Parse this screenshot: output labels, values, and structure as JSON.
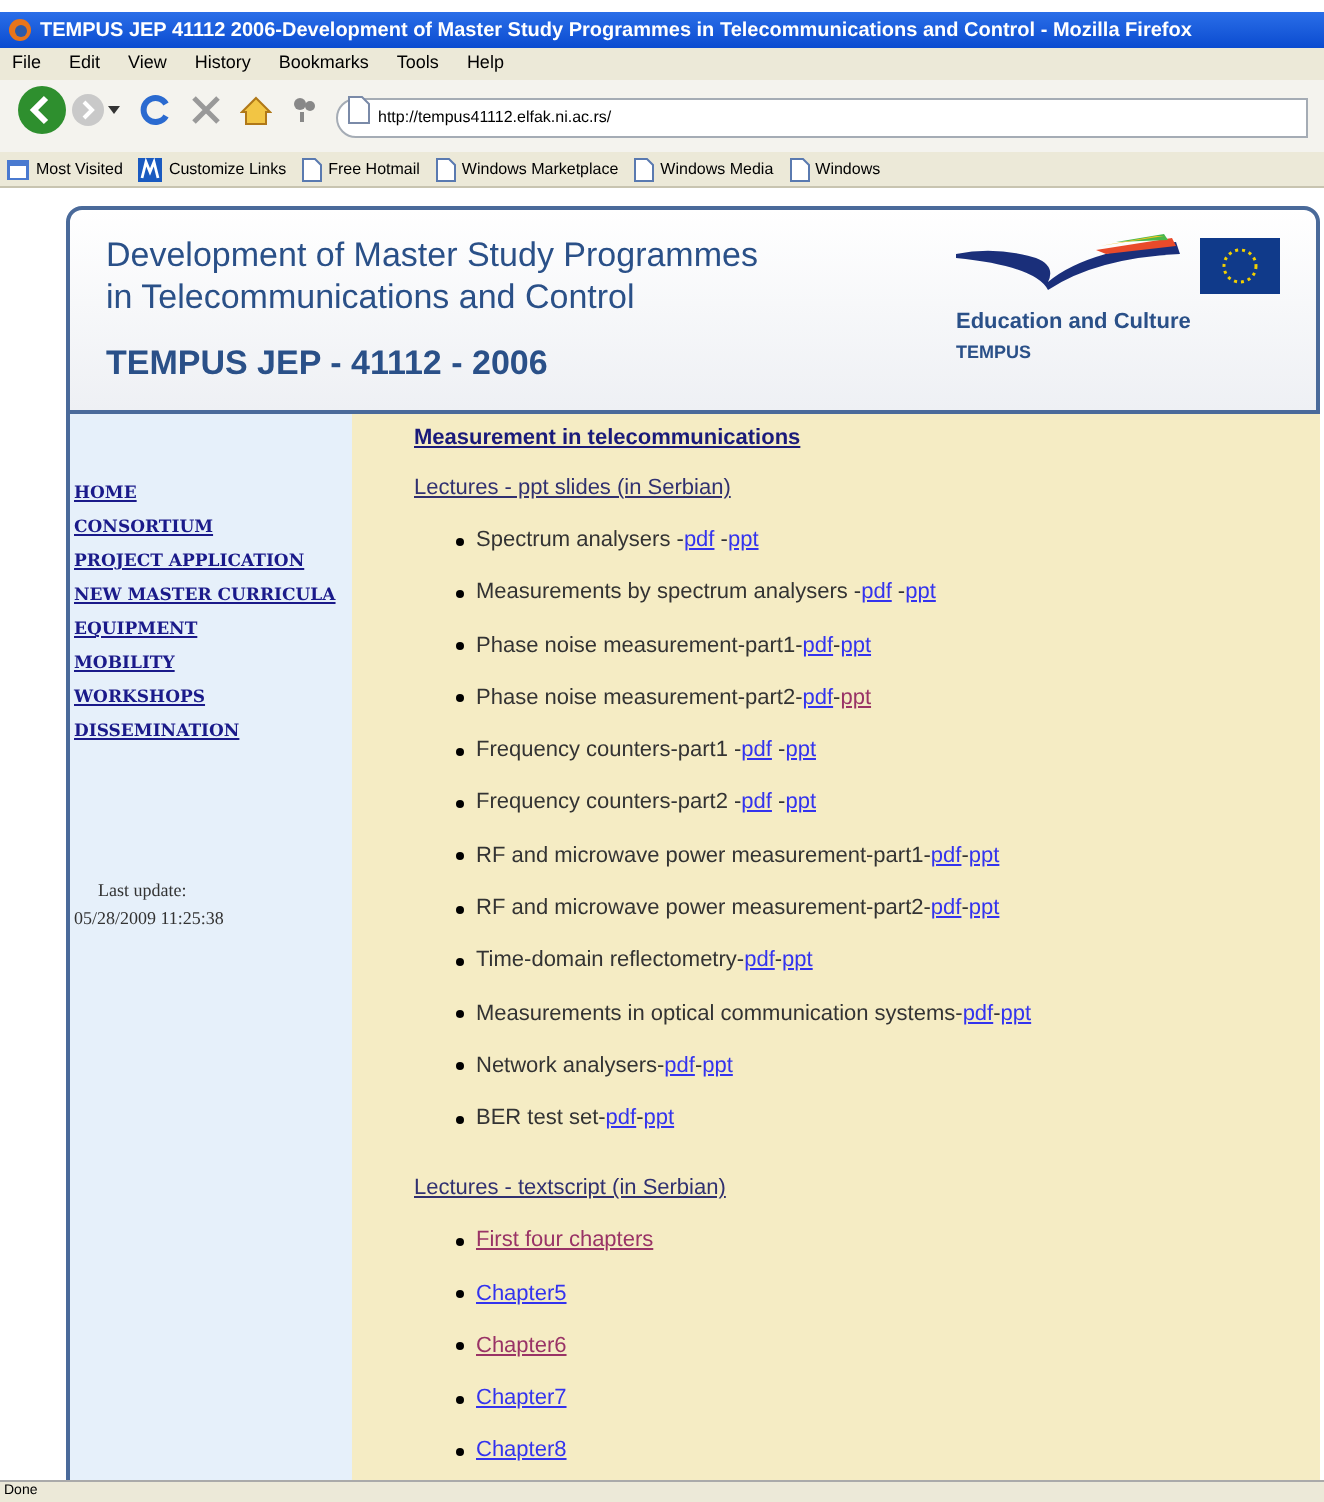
{
  "window": {
    "title": "TEMPUS JEP 41112 2006-Development of Master Study Programmes in Telecommunications and Control - Mozilla Firefox"
  },
  "menu": [
    "File",
    "Edit",
    "View",
    "History",
    "Bookmarks",
    "Tools",
    "Help"
  ],
  "address": {
    "value": "http://tempus41112.elfak.ni.ac.rs/"
  },
  "bookmarks": [
    {
      "label": "Most Visited",
      "kind": "folder"
    },
    {
      "label": "Customize Links",
      "kind": "site"
    },
    {
      "label": "Free Hotmail",
      "kind": "page"
    },
    {
      "label": "Windows Marketplace",
      "kind": "page"
    },
    {
      "label": "Windows Media",
      "kind": "page"
    },
    {
      "label": "Windows",
      "kind": "page"
    }
  ],
  "header": {
    "title_lines": [
      "Development of Master Study Programmes",
      "in Telecommunications and Control"
    ],
    "project": "TEMPUS JEP - 41112 - 2006",
    "logo_caption": "Education and Culture",
    "logo_subcaption": "TEMPUS"
  },
  "sidebar": {
    "items": [
      "HOME",
      "CONSORTIUM",
      "PROJECT APPLICATION",
      "NEW MASTER CURRICULA",
      "EQUIPMENT",
      "MOBILITY",
      "WORKSHOPS",
      "DISSEMINATION"
    ],
    "last_update_label": "Last update:",
    "last_update": "05/28/2009 11:25:38"
  },
  "content": {
    "heading": "Measurement in telecommunications",
    "sections": [
      {
        "title": "Lectures - ppt slides (in Serbian)",
        "items": [
          {
            "parts": [
              {
                "kind": "text",
                "text": "Spectrum analysers -"
              },
              {
                "kind": "link",
                "text": "pdf",
                "visited": false
              },
              {
                "kind": "text",
                "text": " -"
              },
              {
                "kind": "link",
                "text": "ppt",
                "visited": false
              }
            ]
          },
          {
            "parts": [
              {
                "kind": "text",
                "text": "Measurements by spectrum analysers -"
              },
              {
                "kind": "link",
                "text": "pdf",
                "visited": false
              },
              {
                "kind": "text",
                "text": " -"
              },
              {
                "kind": "link",
                "text": "ppt",
                "visited": false
              }
            ]
          },
          {
            "parts": [
              {
                "kind": "text",
                "text": "Phase noise measurement-part1-"
              },
              {
                "kind": "link",
                "text": "pdf",
                "visited": false
              },
              {
                "kind": "text",
                "text": "-"
              },
              {
                "kind": "link",
                "text": "ppt",
                "visited": false
              }
            ]
          },
          {
            "parts": [
              {
                "kind": "text",
                "text": "Phase noise measurement-part2-"
              },
              {
                "kind": "link",
                "text": "pdf",
                "visited": false
              },
              {
                "kind": "text",
                "text": "-"
              },
              {
                "kind": "link",
                "text": "ppt",
                "visited": true
              }
            ]
          },
          {
            "parts": [
              {
                "kind": "text",
                "text": "Frequency counters-part1 -"
              },
              {
                "kind": "link",
                "text": "pdf",
                "visited": false
              },
              {
                "kind": "text",
                "text": " -"
              },
              {
                "kind": "link",
                "text": "ppt",
                "visited": false
              }
            ]
          },
          {
            "parts": [
              {
                "kind": "text",
                "text": "Frequency counters-part2 -"
              },
              {
                "kind": "link",
                "text": "pdf",
                "visited": false
              },
              {
                "kind": "text",
                "text": " -"
              },
              {
                "kind": "link",
                "text": "ppt",
                "visited": false
              }
            ]
          },
          {
            "parts": [
              {
                "kind": "text",
                "text": "RF and microwave power measurement-part1-"
              },
              {
                "kind": "link",
                "text": "pdf",
                "visited": false
              },
              {
                "kind": "text",
                "text": "-"
              },
              {
                "kind": "link",
                "text": "ppt",
                "visited": false
              }
            ]
          },
          {
            "parts": [
              {
                "kind": "text",
                "text": "RF and microwave power measurement-part2-"
              },
              {
                "kind": "link",
                "text": "pdf",
                "visited": false
              },
              {
                "kind": "text",
                "text": "-"
              },
              {
                "kind": "link",
                "text": "ppt",
                "visited": false
              }
            ]
          },
          {
            "parts": [
              {
                "kind": "text",
                "text": "Time-domain reflectometry-"
              },
              {
                "kind": "link",
                "text": "pdf",
                "visited": false
              },
              {
                "kind": "text",
                "text": "-"
              },
              {
                "kind": "link",
                "text": "ppt",
                "visited": false
              }
            ]
          },
          {
            "parts": [
              {
                "kind": "text",
                "text": "Measurements in optical communication systems-"
              },
              {
                "kind": "link",
                "text": "pdf",
                "visited": false
              },
              {
                "kind": "text",
                "text": "-"
              },
              {
                "kind": "link",
                "text": "ppt",
                "visited": false
              }
            ]
          },
          {
            "parts": [
              {
                "kind": "text",
                "text": "Network analysers-"
              },
              {
                "kind": "link",
                "text": "pdf",
                "visited": false
              },
              {
                "kind": "text",
                "text": "-"
              },
              {
                "kind": "link",
                "text": "ppt",
                "visited": false
              }
            ]
          },
          {
            "parts": [
              {
                "kind": "text",
                "text": "BER test set-"
              },
              {
                "kind": "link",
                "text": "pdf",
                "visited": false
              },
              {
                "kind": "text",
                "text": "-"
              },
              {
                "kind": "link",
                "text": "ppt",
                "visited": false
              }
            ]
          }
        ]
      },
      {
        "title": "Lectures - textscript (in Serbian)",
        "items": [
          {
            "parts": [
              {
                "kind": "link",
                "text": "First four chapters",
                "visited": true
              }
            ]
          },
          {
            "parts": [
              {
                "kind": "link",
                "text": "Chapter5",
                "visited": false
              }
            ]
          },
          {
            "parts": [
              {
                "kind": "link",
                "text": "Chapter6",
                "visited": true
              }
            ]
          },
          {
            "parts": [
              {
                "kind": "link",
                "text": "Chapter7",
                "visited": false
              }
            ]
          },
          {
            "parts": [
              {
                "kind": "link",
                "text": "Chapter8",
                "visited": false
              }
            ]
          }
        ]
      }
    ]
  },
  "status_bar": "Done"
}
